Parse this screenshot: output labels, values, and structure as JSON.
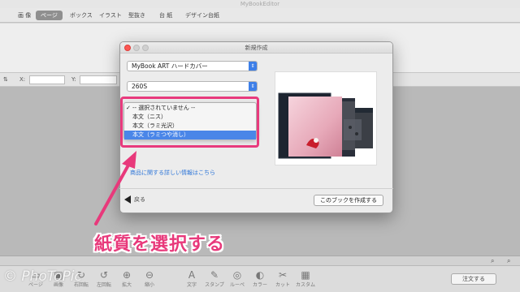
{
  "window": {
    "title": "MyBookEditor"
  },
  "toolbar": {
    "tabs": [
      "画 像",
      "ページ",
      "ボックス",
      "イラスト",
      "型抜き",
      "台 紙",
      "デザイン台紙"
    ],
    "active_index": 1
  },
  "coords": {
    "x_label": "X:",
    "y_label": "Y:",
    "align_label": "⇅"
  },
  "dialog": {
    "title": "新規作成",
    "product_select": "MyBook ART ハードカバー",
    "size_select": "260S",
    "paper_options": [
      "-- 選択されていません --",
      "本文（ニス）",
      "本文（ラミ光沢）",
      "本文（ラミつや消し）"
    ],
    "checked_option_index": 0,
    "highlighted_option_index": 3,
    "info_link": "商品に関する詳しい情報はこちら",
    "back_label": "戻る",
    "create_label": "このブックを作成する"
  },
  "annotation": {
    "caption": "紙質を選択する",
    "color": "#e8397b"
  },
  "bottom_toolbar": {
    "items": [
      "ページ",
      "画像",
      "右回転",
      "左回転",
      "拡大",
      "縮小",
      "文字",
      "スタンプ",
      "ルーペ",
      "カラー",
      "カット",
      "カスタム"
    ],
    "order_label": "注文する"
  },
  "watermark": "© PhoToPic"
}
